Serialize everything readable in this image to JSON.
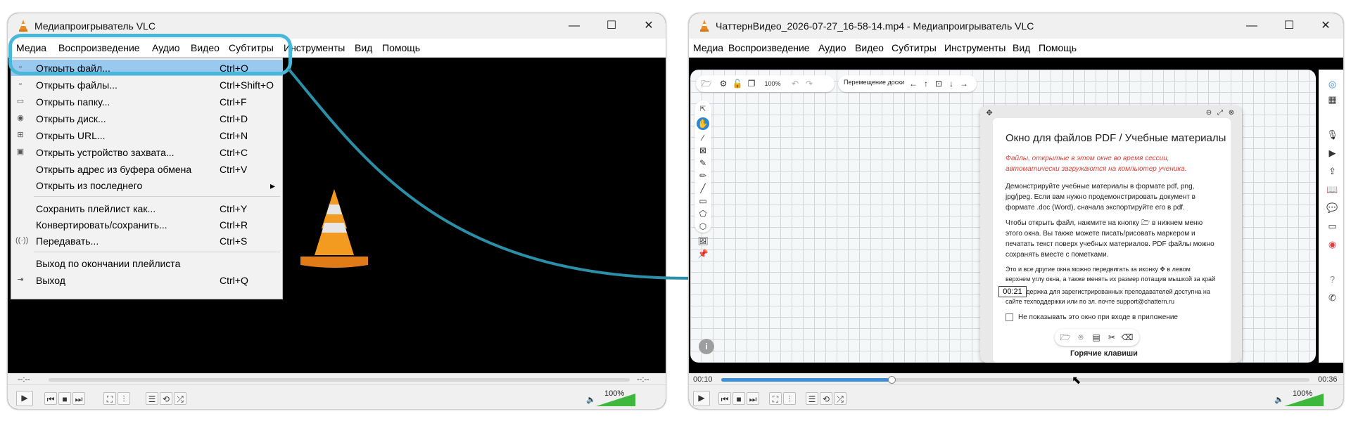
{
  "left_window": {
    "title": "Медиапроигрыватель VLC",
    "window_controls": {
      "minimize": "—",
      "maximize": "☐",
      "close": "✕"
    },
    "menubar": [
      "Медиа",
      "Воспроизведение",
      "Аудио",
      "Видео",
      "Субтитры",
      "Инструменты",
      "Вид",
      "Помощь"
    ],
    "media_menu": [
      {
        "icon": "open-file-icon",
        "label": "Открыть файл...",
        "shortcut": "Ctrl+O"
      },
      {
        "icon": "open-files-icon",
        "label": "Открыть файлы...",
        "shortcut": "Ctrl+Shift+O"
      },
      {
        "icon": "folder-icon",
        "label": "Открыть папку...",
        "shortcut": "Ctrl+F"
      },
      {
        "icon": "disc-icon",
        "label": "Открыть диск...",
        "shortcut": "Ctrl+D"
      },
      {
        "icon": "network-icon",
        "label": "Открыть URL...",
        "shortcut": "Ctrl+N"
      },
      {
        "icon": "capture-icon",
        "label": "Открыть устройство захвата...",
        "shortcut": "Ctrl+C"
      },
      {
        "icon": "",
        "label": "Открыть адрес из буфера обмена",
        "shortcut": "Ctrl+V"
      },
      {
        "icon": "",
        "label": "Открыть из последнего",
        "shortcut": "▸"
      },
      {
        "icon": "",
        "label": "Сохранить плейлист как...",
        "shortcut": "Ctrl+Y"
      },
      {
        "icon": "",
        "label": "Конвертировать/сохранить...",
        "shortcut": "Ctrl+R"
      },
      {
        "icon": "stream-icon",
        "label": "Передавать...",
        "shortcut": "Ctrl+S"
      },
      {
        "icon": "",
        "label": "Выход по окончании плейлиста",
        "shortcut": ""
      },
      {
        "icon": "exit-icon",
        "label": "Выход",
        "shortcut": "Ctrl+Q"
      }
    ],
    "time_left": "--:--",
    "time_right": "--:--",
    "volume": "100%"
  },
  "right_window": {
    "title": "ЧаттернВидео_2026-07-27_16-58-14.mp4 - Медиапроигрыватель VLC",
    "menubar": [
      "Медиа",
      "Воспроизведение",
      "Аудио",
      "Видео",
      "Субтитры",
      "Инструменты",
      "Вид",
      "Помощь"
    ],
    "zoom": "100%",
    "board_move_label": "Перемещение доски",
    "panel": {
      "title": "Окно для файлов PDF / Учебные материалы",
      "warning": "Файлы, открытые в этом окне во время сессии, автоматически загружаются на компьютер ученика.",
      "p1": "Демонстрируйте учебные материалы в формате pdf, png, jpg/jpeg. Если вам нужно продемонстрировать документ в формате .doc (Word), сначала экспортируйте его в pdf.",
      "p2": "Чтобы открыть файл, нажмите на кнопку 🗁 в нижнем меню этого окна. Вы также можете писать/рисовать маркером и печатать текст поверх учебных материалов. PDF файлы можно сохранять вместе с пометками.",
      "p3": "Это и все другие окна можно передвигать за иконку ✥ в левом верхнем углу окна, а также менять их размер потащив мышкой за край окна.",
      "p4": "Техподдержка для зарегистрированных преподавателей доступна на сайте техподдержки или по эл. почте support@chattern.ru",
      "checkbox": "Не показывать это окно при входе в приложение",
      "bottom": "Горячие клавиши"
    },
    "tooltip_time": "00:21",
    "time_left": "00:10",
    "time_right": "00:36",
    "progress": 0.29,
    "volume": "100%"
  },
  "colors": {
    "accent": "#49b8d8",
    "menu_highlight": "#99c9ef",
    "progress": "#3a8fd8",
    "vlc_orange": "#f08c1e"
  }
}
